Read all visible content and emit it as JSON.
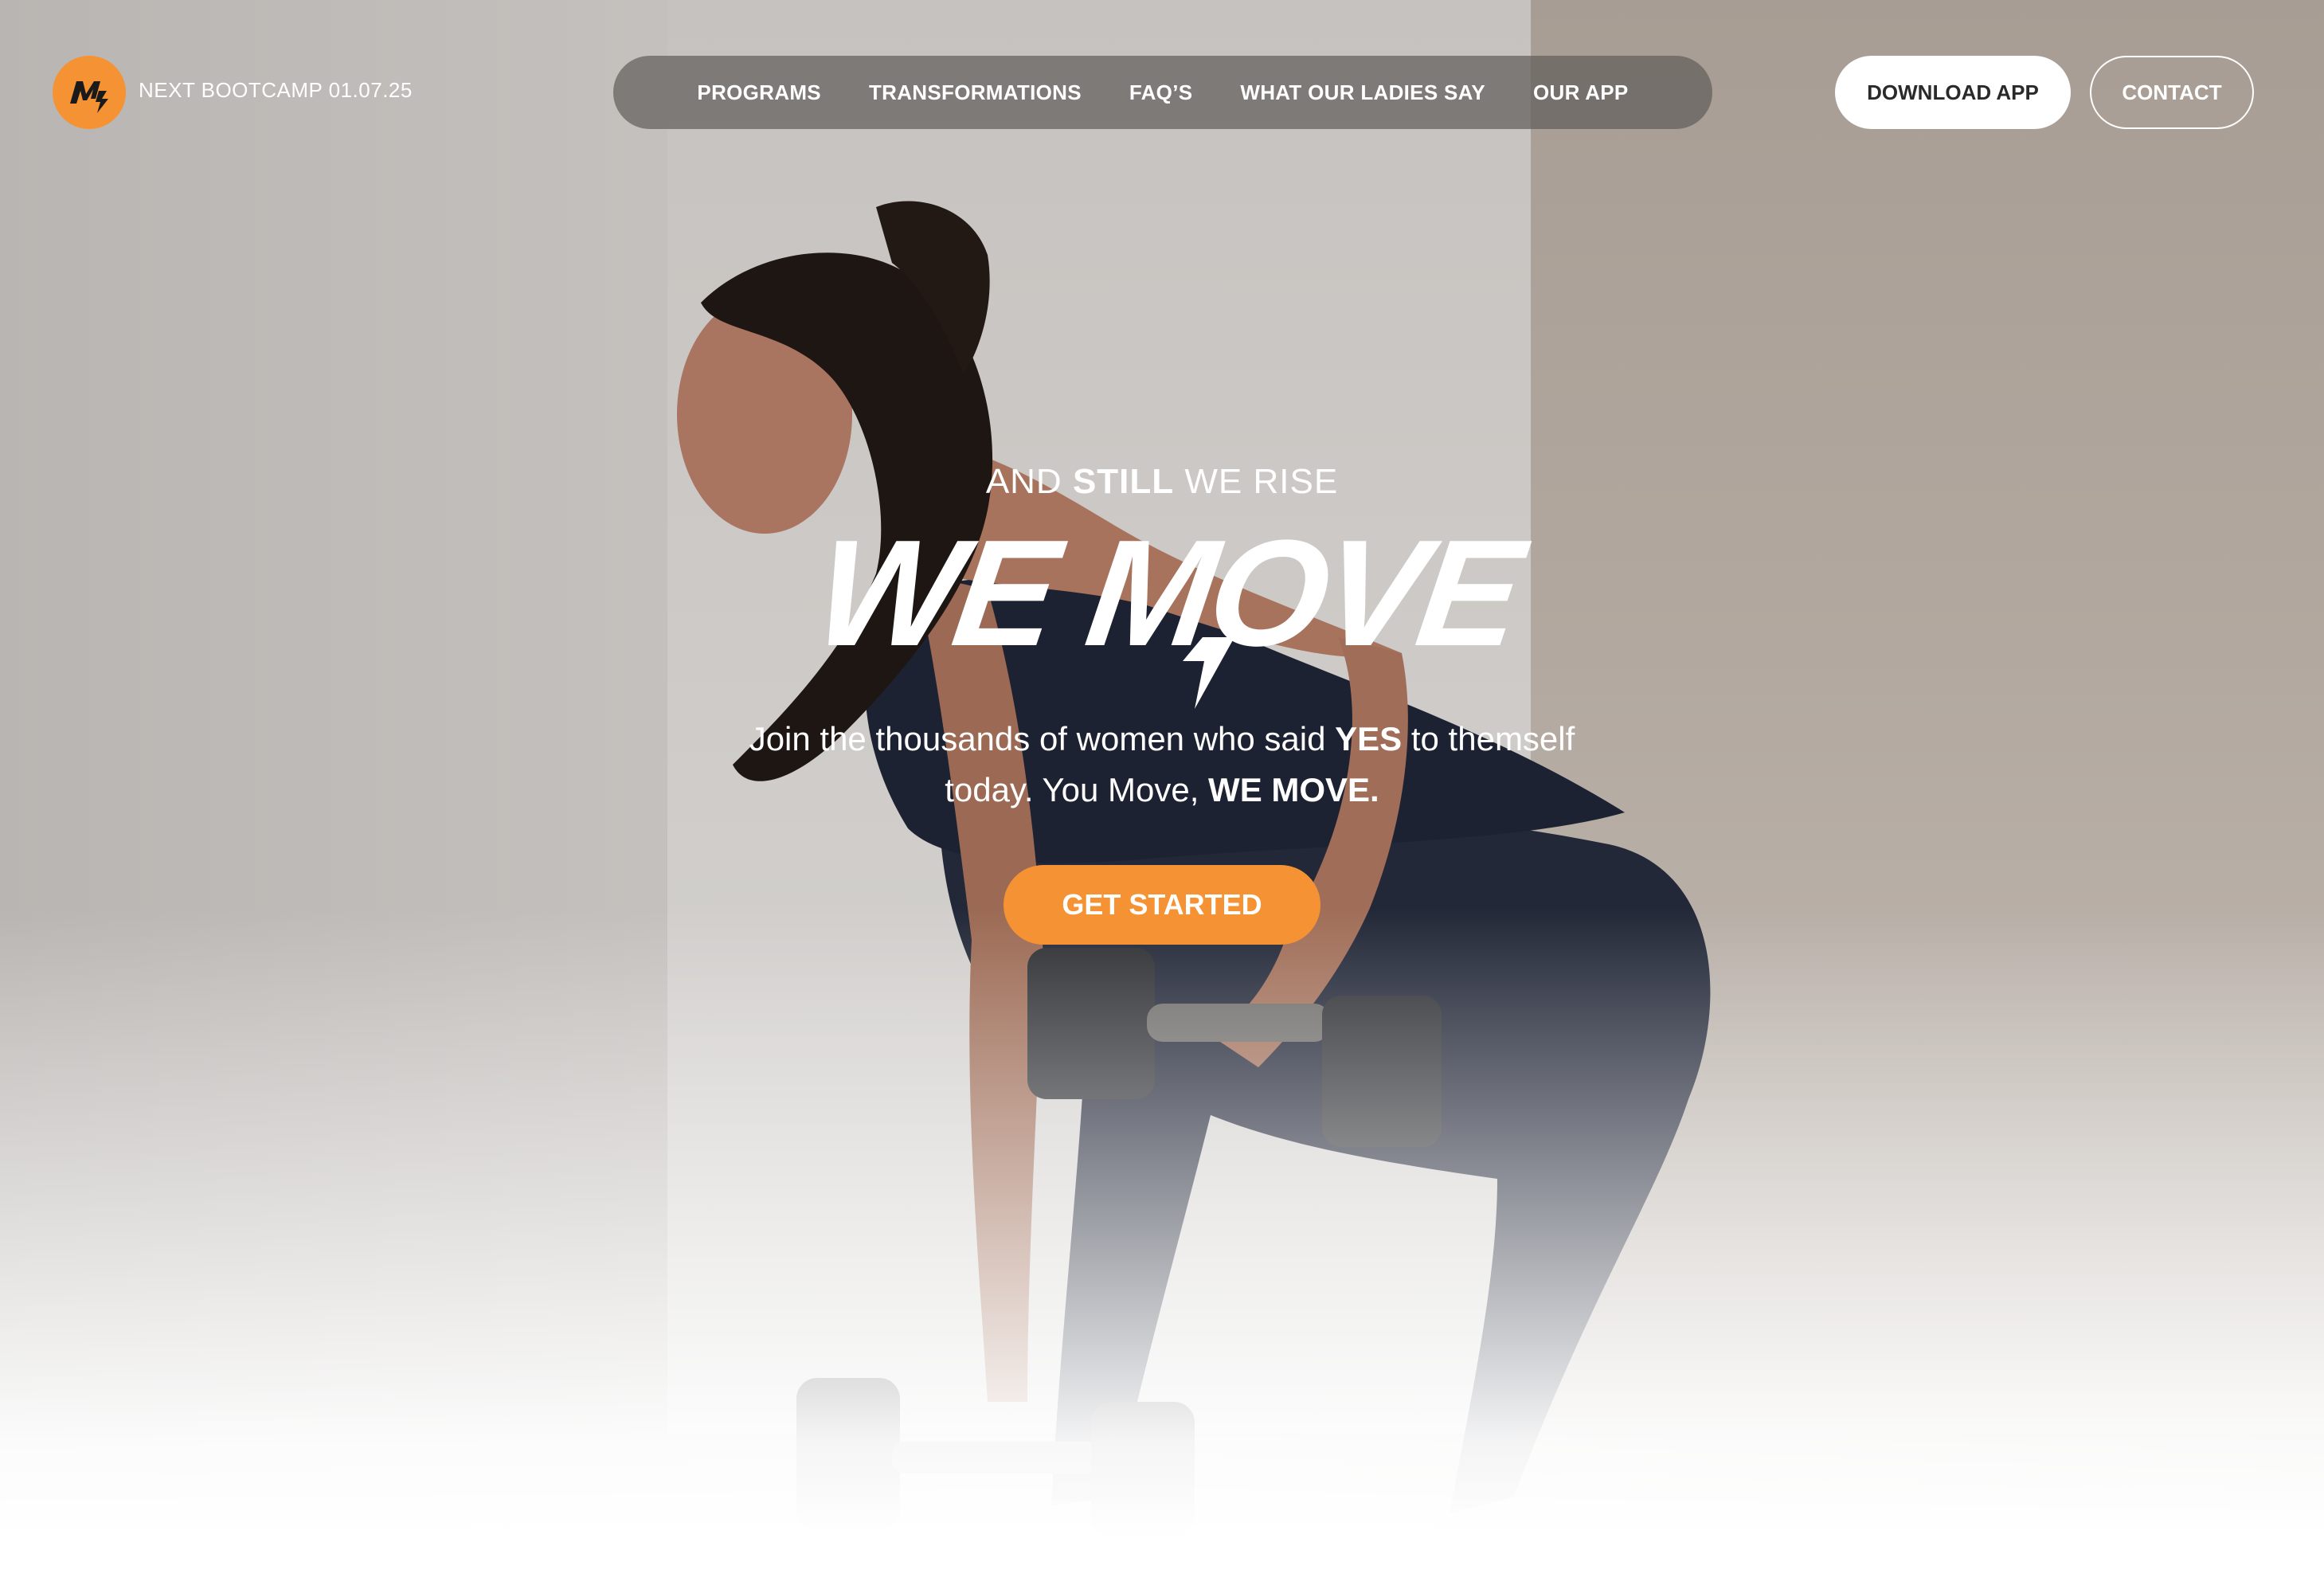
{
  "header": {
    "logo_icon": "bolt-m-logo-icon",
    "bootcamp_label": "NEXT BOOTCAMP 01.07.25",
    "nav": [
      {
        "label": "PROGRAMS"
      },
      {
        "label": "TRANSFORMATIONS"
      },
      {
        "label": "FAQ’S"
      },
      {
        "label": "WHAT OUR LADIES SAY"
      },
      {
        "label": "OUR APP"
      }
    ],
    "download_label": "DOWNLOAD APP",
    "contact_label": "CONTACT"
  },
  "hero": {
    "tagline_pre": "AND ",
    "tagline_bold": "STILL",
    "tagline_post": " WE RISE",
    "headline": "WE MOVE",
    "subtext_1": "Join the thousands of women who said ",
    "subtext_yes": "YES",
    "subtext_2": " to themself today. You Move, ",
    "subtext_bold": "WE MOVE.",
    "cta_label": "GET STARTED"
  },
  "colors": {
    "accent": "#f59233",
    "nav_pill": "#625e5c",
    "text_light": "#ffffff"
  }
}
